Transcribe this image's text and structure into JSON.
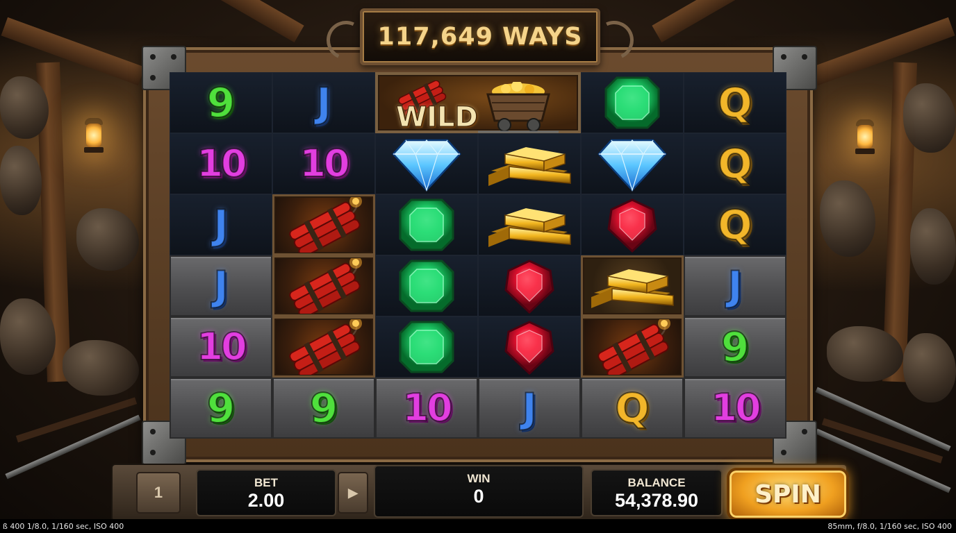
{
  "title": "117,649 WAYS",
  "grid": {
    "rows": [
      [
        {
          "sym": "9",
          "bg": "dark"
        },
        {
          "sym": "J",
          "bg": "dark"
        },
        {
          "sym": "wild",
          "bg": "wild"
        },
        {
          "sym": "wild",
          "bg": "wild"
        },
        {
          "sym": "emerald",
          "bg": "dark"
        },
        {
          "sym": "Q",
          "bg": "dark"
        }
      ],
      [
        {
          "sym": "10",
          "bg": "dark"
        },
        {
          "sym": "10",
          "bg": "dark"
        },
        {
          "sym": "diamond",
          "bg": "dark"
        },
        {
          "sym": "gold",
          "bg": "dark"
        },
        {
          "sym": "diamond",
          "bg": "dark"
        },
        {
          "sym": "Q",
          "bg": "dark"
        }
      ],
      [
        {
          "sym": "J",
          "bg": "dark"
        },
        {
          "sym": "dynamite",
          "bg": "framed"
        },
        {
          "sym": "emerald",
          "bg": "dark"
        },
        {
          "sym": "gold",
          "bg": "dark"
        },
        {
          "sym": "ruby",
          "bg": "dark"
        },
        {
          "sym": "Q",
          "bg": "dark"
        }
      ],
      [
        {
          "sym": "J",
          "bg": "stone"
        },
        {
          "sym": "dynamite",
          "bg": "framed"
        },
        {
          "sym": "emerald",
          "bg": "dark"
        },
        {
          "sym": "ruby",
          "bg": "dark"
        },
        {
          "sym": "gold",
          "bg": "framed-gold"
        },
        {
          "sym": "J",
          "bg": "stone"
        }
      ],
      [
        {
          "sym": "10",
          "bg": "stone"
        },
        {
          "sym": "dynamite",
          "bg": "framed"
        },
        {
          "sym": "emerald",
          "bg": "dark"
        },
        {
          "sym": "ruby",
          "bg": "dark"
        },
        {
          "sym": "dynamite",
          "bg": "framed"
        },
        {
          "sym": "9",
          "bg": "stone"
        }
      ],
      [
        {
          "sym": "9",
          "bg": "stone"
        },
        {
          "sym": "9",
          "bg": "stone"
        },
        {
          "sym": "10",
          "bg": "stone"
        },
        {
          "sym": "J",
          "bg": "stone"
        },
        {
          "sym": "Q",
          "bg": "stone"
        },
        {
          "sym": "10",
          "bg": "stone"
        }
      ]
    ],
    "wild_label": "WILD"
  },
  "controls": {
    "level_button": "1",
    "bet_label": "BET",
    "bet_value": "2.00",
    "win_label": "WIN",
    "win_value": "0",
    "balance_label": "BALANCE",
    "balance_value": "54,378.90",
    "spin_label": "SPIN",
    "arrow_icon": "play-arrow-icon"
  },
  "camera": {
    "left": "ß 400   1/8.0, 1/160 sec, ISO 400",
    "right": "85mm, f/8.0, 1/160 sec, ISO 400"
  },
  "colors": {
    "sym_9": "#4fe03c",
    "sym_10": "#e23ee0",
    "sym_J": "#3f83ee",
    "sym_Q": "#f2b62a",
    "spin": "#f0a020"
  }
}
